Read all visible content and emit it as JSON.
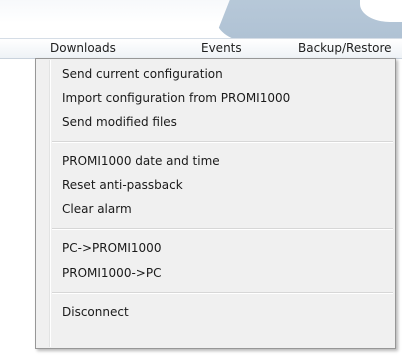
{
  "menubar": {
    "items": [
      {
        "label": "Downloads"
      },
      {
        "label": "Events"
      },
      {
        "label": "Backup/Restore"
      }
    ]
  },
  "dropdown": {
    "items": [
      {
        "label": "Send current configuration"
      },
      {
        "label": "Import configuration from PROMI1000"
      },
      {
        "label": "Send modified files"
      },
      {
        "label": "PROMI1000 date and time"
      },
      {
        "label": "Reset anti-passback"
      },
      {
        "label": "Clear alarm"
      },
      {
        "label": "PC->PROMI1000"
      },
      {
        "label": "PROMI1000->PC"
      },
      {
        "label": "Disconnect"
      }
    ]
  }
}
